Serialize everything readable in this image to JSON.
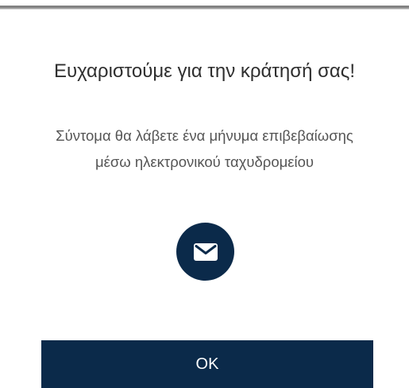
{
  "dialog": {
    "title": "Ευχαριστούμε για την κράτησή σας!",
    "message": "Σύντομα θα λάβετε ένα μήνυμα επιβεβαίωσης μέσω ηλεκτρονικού ταχυδρομείου",
    "icon": "envelope-icon",
    "ok_label": "OK"
  },
  "colors": {
    "primary": "#0b2a4a",
    "title_text": "#2f2f2f",
    "body_text": "#555555",
    "background": "#ffffff"
  }
}
